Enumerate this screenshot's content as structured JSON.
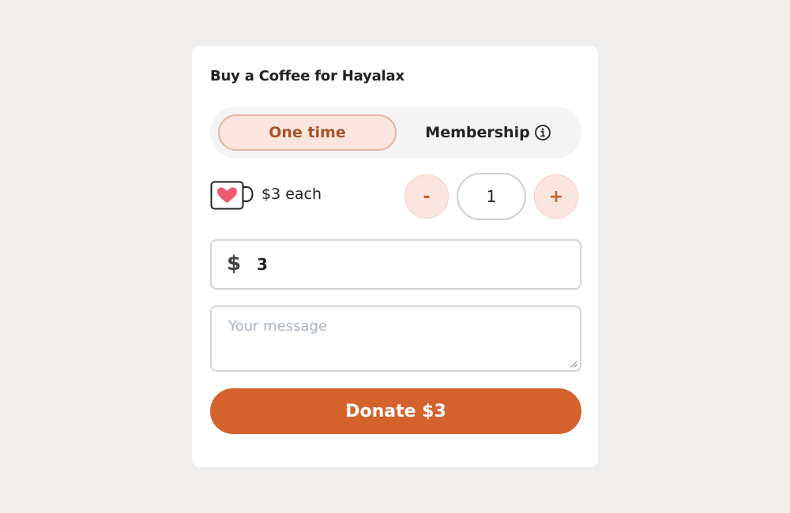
{
  "card": {
    "title": "Buy a Coffee for Hayalax"
  },
  "toggle": {
    "one_time_label": "One time",
    "membership_label": "Membership",
    "selected": "One time"
  },
  "price": {
    "each_label": "$3 each",
    "quantity": "1",
    "minus_label": "-",
    "plus_label": "+"
  },
  "amount": {
    "currency_symbol": "$",
    "value": "3"
  },
  "message": {
    "placeholder": "Your message",
    "value": ""
  },
  "donate": {
    "label": "Donate $3"
  },
  "colors": {
    "accent": "#d3622d",
    "accent_light": "#fbe6df",
    "heart": "#ee5a6f",
    "page_background": "#efeeec"
  },
  "icons": {
    "info": "info-circle-icon",
    "mug": "heart-mug-icon"
  }
}
